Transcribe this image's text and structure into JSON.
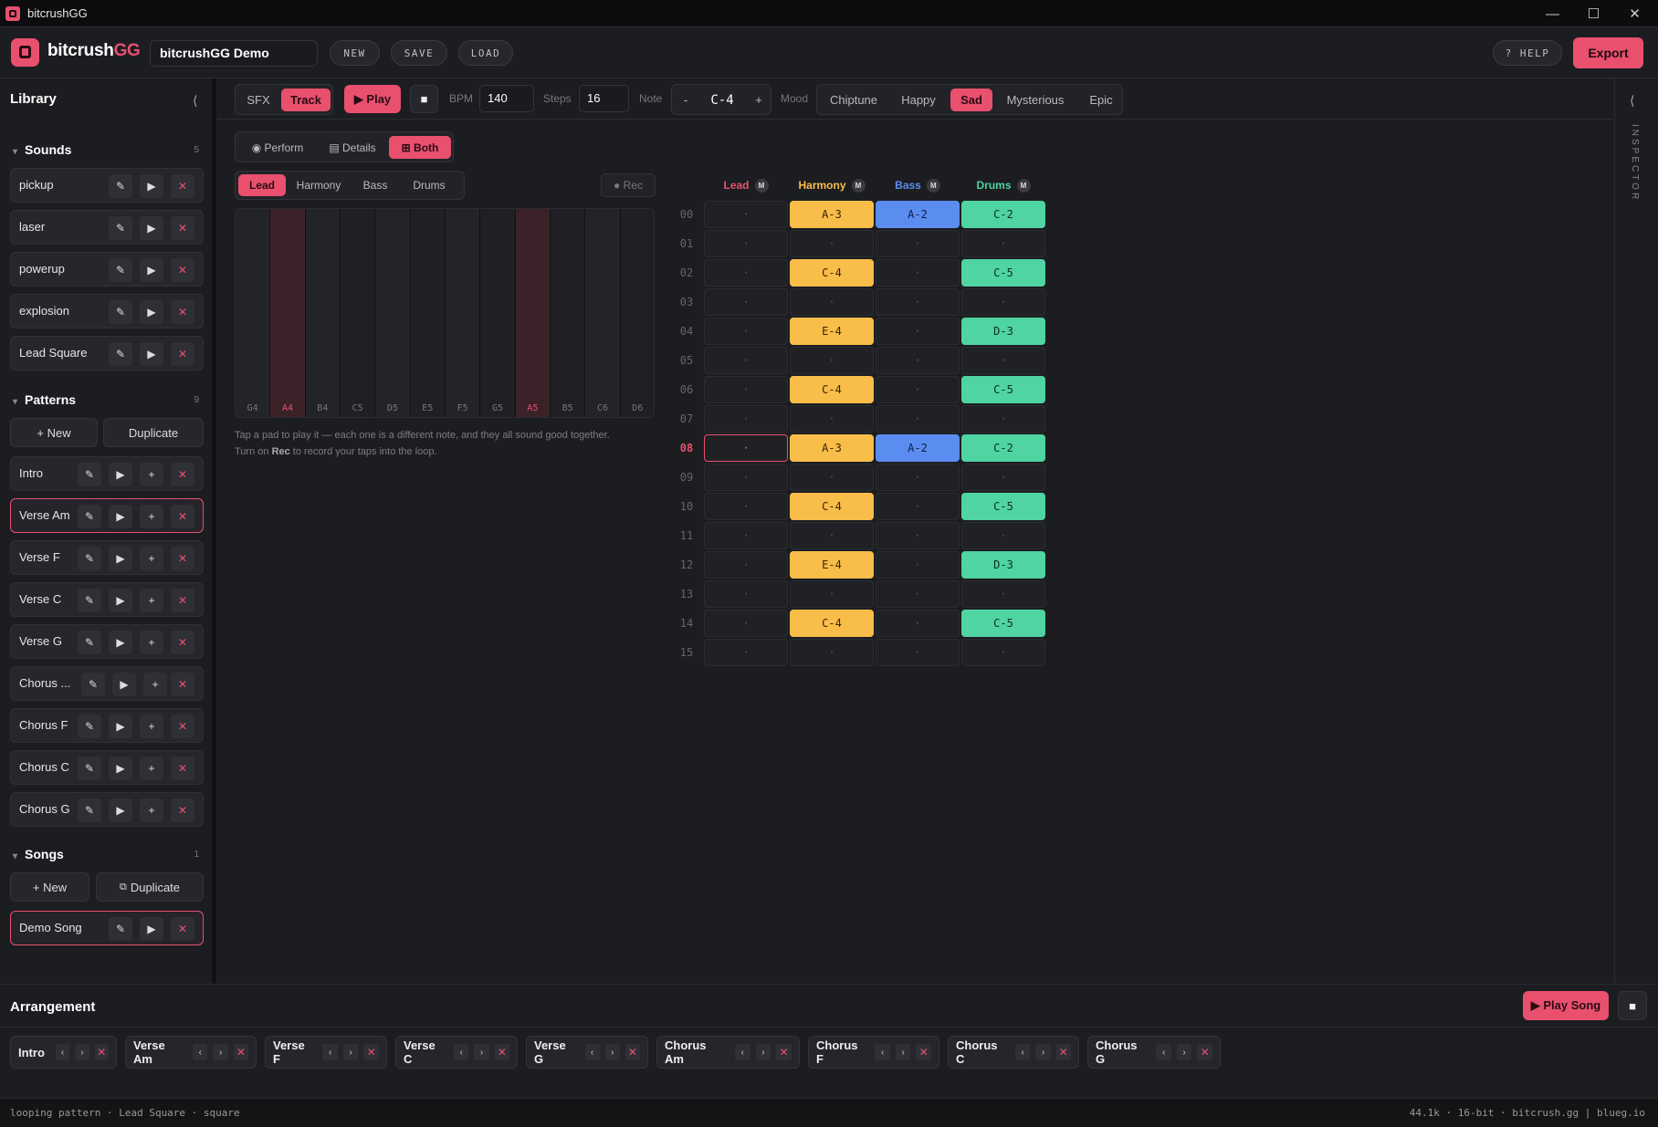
{
  "window": {
    "title": "bitcrushGG",
    "min": "—",
    "max": "☐",
    "close": "✕"
  },
  "header": {
    "brand_main": "bitcrush",
    "brand_accent": "GG",
    "project_name": "bitcrushGG Demo",
    "new": "NEW",
    "save": "SAVE",
    "load": "LOAD",
    "help": "? HELP",
    "export": "Export"
  },
  "sidebar": {
    "title": "Library",
    "collapse": "⟨",
    "sounds": {
      "title": "Sounds",
      "count": "5",
      "items": [
        "pickup",
        "laser",
        "powerup",
        "explosion",
        "Lead Square"
      ]
    },
    "patterns": {
      "title": "Patterns",
      "count": "9",
      "new": "+ New",
      "duplicate": "Duplicate",
      "items": [
        "Intro",
        "Verse Am",
        "Verse F",
        "Verse C",
        "Verse G",
        "Chorus ...",
        "Chorus F",
        "Chorus C",
        "Chorus G"
      ],
      "selected": "Verse Am"
    },
    "songs": {
      "title": "Songs",
      "count": "1",
      "new": "+ New",
      "duplicate": "Duplicate",
      "items": [
        "Demo Song"
      ]
    }
  },
  "toolbar": {
    "sfx": "SFX",
    "track": "Track",
    "play": "▶ Play",
    "stop": "■",
    "bpm_label": "BPM",
    "bpm": "140",
    "steps_label": "Steps",
    "steps": "16",
    "note_label": "Note",
    "note_minus": "-",
    "note": "C-4",
    "note_plus": "+",
    "mood_label": "Mood",
    "moods": [
      "Chiptune",
      "Happy",
      "Sad",
      "Mysterious",
      "Epic"
    ],
    "mood_selected": "Sad"
  },
  "view": {
    "perform": "◉ Perform",
    "details": "▤ Details",
    "both": "⊞ Both"
  },
  "perform": {
    "tabs": [
      "Lead",
      "Harmony",
      "Bass",
      "Drums"
    ],
    "selected": "Lead",
    "rec": "● Rec",
    "pads": [
      "G4",
      "A4",
      "B4",
      "C5",
      "D5",
      "E5",
      "F5",
      "G5",
      "A5",
      "B5",
      "C6",
      "D6"
    ],
    "help1": "Tap a pad to play it — each one is a different note, and they all sound good together.",
    "help2_pre": "Turn on ",
    "help2_bold": "Rec",
    "help2_post": " to record your taps into the loop."
  },
  "tracker": {
    "cols": [
      {
        "name": "Lead",
        "m": "M",
        "color": "#e8506e"
      },
      {
        "name": "Harmony",
        "m": "M",
        "color": "#f9bd4a"
      },
      {
        "name": "Bass",
        "m": "M",
        "color": "#5b8df0"
      },
      {
        "name": "Drums",
        "m": "M",
        "color": "#4fd4a2"
      }
    ],
    "rows": [
      "00",
      "01",
      "02",
      "03",
      "04",
      "05",
      "06",
      "07",
      "08",
      "09",
      "10",
      "11",
      "12",
      "13",
      "14",
      "15"
    ],
    "empty": "·",
    "harmony": [
      "A-3",
      "",
      "C-4",
      "",
      "E-4",
      "",
      "C-4",
      "",
      "A-3",
      "",
      "C-4",
      "",
      "E-4",
      "",
      "C-4",
      ""
    ],
    "bass": [
      "A-2",
      "",
      "",
      "",
      "",
      "",
      "",
      "",
      "A-2",
      "",
      "",
      "",
      "",
      "",
      "",
      ""
    ],
    "drums": [
      "C-2",
      "",
      "C-5",
      "",
      "D-3",
      "",
      "C-5",
      "",
      "C-2",
      "",
      "C-5",
      "",
      "D-3",
      "",
      "C-5",
      ""
    ],
    "current_row": "08"
  },
  "inspector": {
    "label": "INSPECTOR",
    "collapse": "⟨"
  },
  "arrangement": {
    "title": "Arrangement",
    "play_song": "▶ Play Song",
    "stop": "■",
    "chips": [
      "Intro",
      "Verse Am",
      "Verse F",
      "Verse C",
      "Verse G",
      "Chorus Am",
      "Chorus F",
      "Chorus C",
      "Chorus G"
    ]
  },
  "status": {
    "left": "looping pattern · Lead Square · square",
    "right": "44.1k · 16-bit · bitcrush.gg | blueg.io"
  }
}
